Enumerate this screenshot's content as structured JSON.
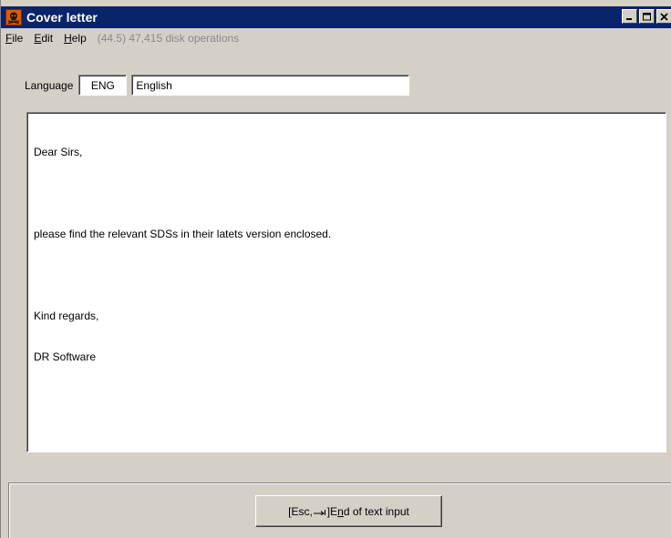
{
  "window": {
    "title": "Cover letter",
    "buttons": [
      "minimize",
      "maximize",
      "close"
    ]
  },
  "menu": {
    "file": {
      "pre": "",
      "accel": "F",
      "post": "ile"
    },
    "edit": {
      "pre": "",
      "accel": "E",
      "post": "dit"
    },
    "help": {
      "pre": "",
      "accel": "H",
      "post": "elp"
    },
    "status": "(44.5) 47,415 disk operations"
  },
  "language": {
    "label": "Language",
    "code": "ENG",
    "name": "English"
  },
  "letter": {
    "lines": [
      "Dear Sirs,",
      "",
      "please find the relevant SDSs in their latets version enclosed.",
      "",
      "Kind regards,",
      "DR Software"
    ]
  },
  "end_button": {
    "prefix": "[Esc, ",
    "arrow": "→ı",
    "bracket": "] ",
    "pre": "E",
    "accel": "n",
    "post": "d of text input"
  },
  "colors": {
    "titlebar": "#0a246a",
    "window_bg": "#d4d0c8",
    "status_text": "#8a8a8a",
    "app_icon": "#e05a00"
  },
  "icons": {
    "app": "hazard-skull-icon",
    "minimize": "minimize-icon",
    "maximize": "maximize-icon",
    "close": "close-icon"
  }
}
